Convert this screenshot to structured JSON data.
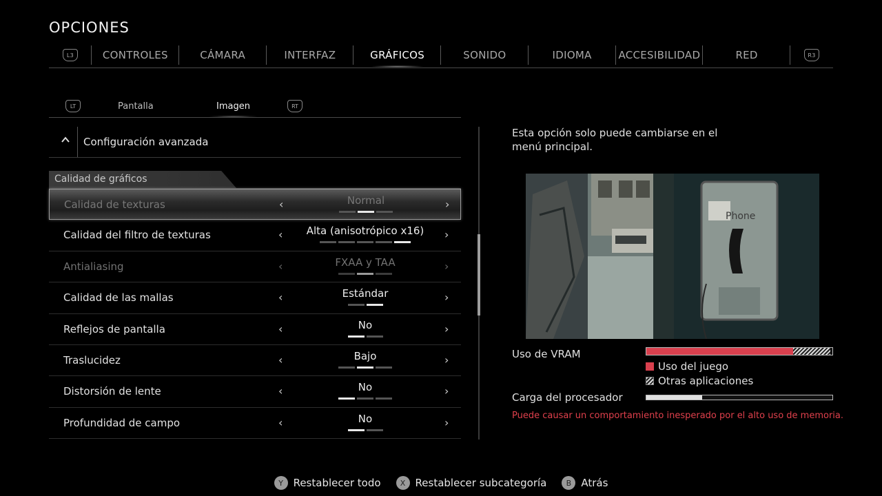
{
  "header": {
    "title": "OPCIONES"
  },
  "tabs": {
    "left_badge": "L3",
    "right_badge": "R3",
    "items": [
      "CONTROLES",
      "CÁMARA",
      "INTERFAZ",
      "GRÁFICOS",
      "SONIDO",
      "IDIOMA",
      "ACCESIBILIDAD",
      "RED"
    ],
    "active": "GRÁFICOS"
  },
  "subtabs": {
    "left_badge": "LT",
    "right_badge": "RT",
    "items": [
      "Pantalla",
      "Imagen"
    ],
    "active": "Imagen"
  },
  "advanced": {
    "label": "Configuración avanzada",
    "expand_icon": "chevron-up-icon"
  },
  "section": {
    "title": "Calidad de gráficos"
  },
  "settings": [
    {
      "label": "Calidad de texturas",
      "value": "Normal",
      "levels": 3,
      "current": 1,
      "state": "selected-locked"
    },
    {
      "label": "Calidad del filtro de texturas",
      "value": "Alta (anisotrópico x16)",
      "levels": 5,
      "current": 4,
      "state": "normal"
    },
    {
      "label": "Antialiasing",
      "value": "FXAA y TAA",
      "levels": 3,
      "current": 1,
      "state": "disabled"
    },
    {
      "label": "Calidad de las mallas",
      "value": "Estándar",
      "levels": 2,
      "current": 1,
      "state": "normal"
    },
    {
      "label": "Reflejos de pantalla",
      "value": "No",
      "levels": 2,
      "current": 0,
      "state": "normal"
    },
    {
      "label": "Traslucidez",
      "value": "Bajo",
      "levels": 3,
      "current": 1,
      "state": "normal"
    },
    {
      "label": "Distorsión de lente",
      "value": "No",
      "levels": 3,
      "current": 0,
      "state": "normal"
    },
    {
      "label": "Profundidad de campo",
      "value": "No",
      "levels": 2,
      "current": 0,
      "state": "normal"
    }
  ],
  "info": {
    "description": "Esta opción solo puede cambiarse en el menú principal.",
    "vram_label": "Uso de VRAM",
    "vram_game_fraction": 0.79,
    "vram_other_fraction": 0.2,
    "legend_game": "Uso del juego",
    "legend_other": "Otras aplicaciones",
    "cpu_label": "Carga del procesador",
    "cpu_fraction": 0.3,
    "warning": "Puede causar un comportamiento inesperado por el alto uso de memoria.",
    "colors": {
      "game": "#d9404e",
      "warning": "#e0404c"
    }
  },
  "footer": [
    {
      "button": "Y",
      "label": "Restablecer todo"
    },
    {
      "button": "X",
      "label": "Restablecer subcategoría"
    },
    {
      "button": "B",
      "label": "Atrás"
    }
  ]
}
